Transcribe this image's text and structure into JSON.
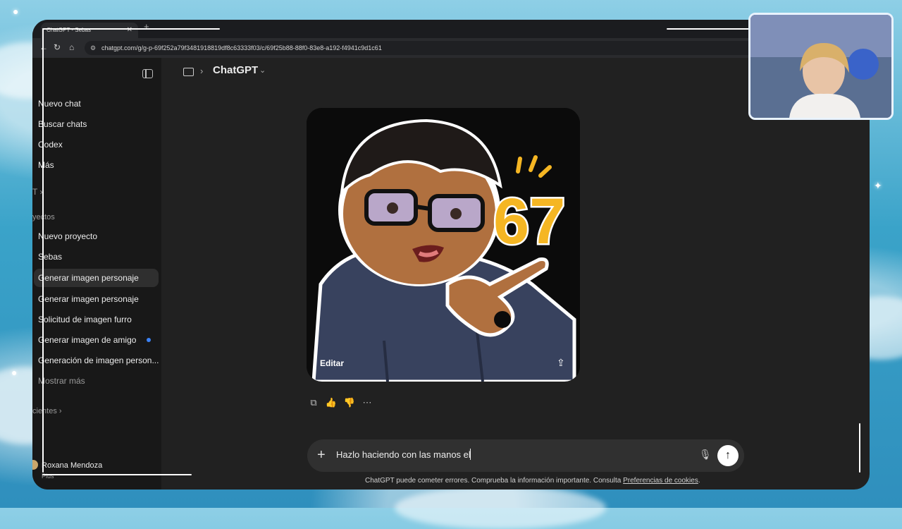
{
  "browser": {
    "tab_title": "ChatGPT - Sebas",
    "url": "chatgpt.com/g/g-p-69f252a79f3481918819df8c63333f03/c/69f25b88-88f0-83e8-a192-f4941c9d1c61"
  },
  "sidebar": {
    "nav": [
      {
        "label": "Nuevo chat"
      },
      {
        "label": "Buscar chats"
      },
      {
        "label": "Codex"
      },
      {
        "label": "Más"
      }
    ],
    "gpts_label": "T",
    "projects_label": "yectos",
    "projects": [
      {
        "label": "Nuevo proyecto"
      },
      {
        "label": "Sebas"
      }
    ],
    "chats": [
      {
        "label": "Generar imagen personaje",
        "active": true
      },
      {
        "label": "Generar imagen personaje"
      },
      {
        "label": "Solicitud de imagen furro"
      },
      {
        "label": "Generar imagen de amigo",
        "unread": true
      },
      {
        "label": "Generación de imagen person..."
      }
    ],
    "show_more": "Mostrar más",
    "recents_label": "cientes",
    "user": {
      "name": "Roxana Mendoza",
      "plan": "Plus"
    }
  },
  "header": {
    "title": "ChatGPT"
  },
  "image_card": {
    "edit_label": "Editar",
    "badge_text": "67"
  },
  "composer": {
    "text": "Hazlo haciendo con las manos el"
  },
  "footer": {
    "note": "ChatGPT puede cometer errores. Comprueba la información importante. Consulta ",
    "link": "Preferencias de cookies",
    "end": "."
  },
  "colors": {
    "accent": "#3b82f6",
    "background": "#212121",
    "sidebar": "#181818"
  }
}
